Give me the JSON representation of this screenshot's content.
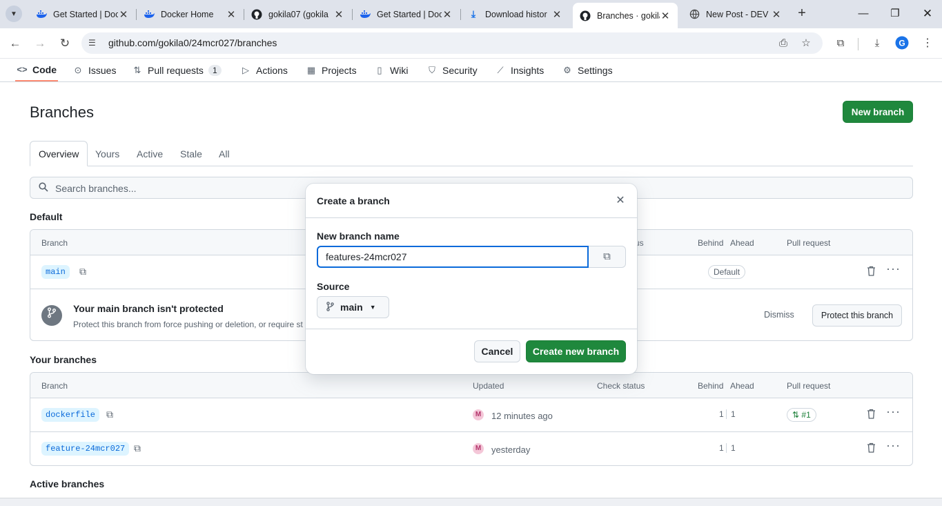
{
  "browser": {
    "tabs": [
      {
        "title": "Get Started | Doc",
        "icon": "docker-icon"
      },
      {
        "title": "Docker Home",
        "icon": "docker-icon"
      },
      {
        "title": "gokila07 (gokila",
        "icon": "github-icon"
      },
      {
        "title": "Get Started | Doc",
        "icon": "docker-icon"
      },
      {
        "title": "Download histor",
        "icon": "download-icon"
      },
      {
        "title": "Branches · gokila",
        "icon": "github-icon",
        "active": true
      },
      {
        "title": "New Post - DEV",
        "icon": "globe-icon"
      }
    ],
    "url": "github.com/gokila0/24mcr027/branches"
  },
  "repo_nav": {
    "code": "Code",
    "issues": "Issues",
    "pull_requests": "Pull requests",
    "pull_requests_count": "1",
    "actions": "Actions",
    "projects": "Projects",
    "wiki": "Wiki",
    "security": "Security",
    "insights": "Insights",
    "settings": "Settings"
  },
  "page": {
    "title": "Branches",
    "new_branch_label": "New branch",
    "tabs": [
      "Overview",
      "Yours",
      "Active",
      "Stale",
      "All"
    ],
    "search_placeholder": "Search branches..."
  },
  "default_section": {
    "heading": "Default",
    "columns": {
      "branch": "Branch",
      "check_status": "us",
      "behind": "Behind",
      "ahead": "Ahead",
      "pull_request": "Pull request"
    },
    "branch": "main",
    "badge": "Default",
    "protect_title": "Your main branch isn't protected",
    "protect_desc": "Protect this branch from force pushing or deletion, or require st",
    "dismiss_label": "Dismiss",
    "protect_label": "Protect this branch"
  },
  "your_branches": {
    "heading": "Your branches",
    "columns": {
      "branch": "Branch",
      "updated": "Updated",
      "check_status": "Check status",
      "behind": "Behind",
      "ahead": "Ahead",
      "pull_request": "Pull request"
    },
    "rows": [
      {
        "name": "dockerfile",
        "updated": "12 minutes ago",
        "behind": "1",
        "ahead": "1",
        "pr": "#1"
      },
      {
        "name": "feature-24mcr027",
        "updated": "yesterday",
        "behind": "1",
        "ahead": "1",
        "pr": ""
      }
    ]
  },
  "active_section": {
    "heading": "Active branches"
  },
  "modal": {
    "title": "Create a branch",
    "name_label": "New branch name",
    "name_value": "features-24mcr027",
    "source_label": "Source",
    "source_value": "main",
    "cancel_label": "Cancel",
    "create_label": "Create new branch"
  },
  "colors": {
    "primary_green": "#1f883d",
    "accent_link": "#0969da",
    "active_tab_underline": "#fd8c73"
  }
}
